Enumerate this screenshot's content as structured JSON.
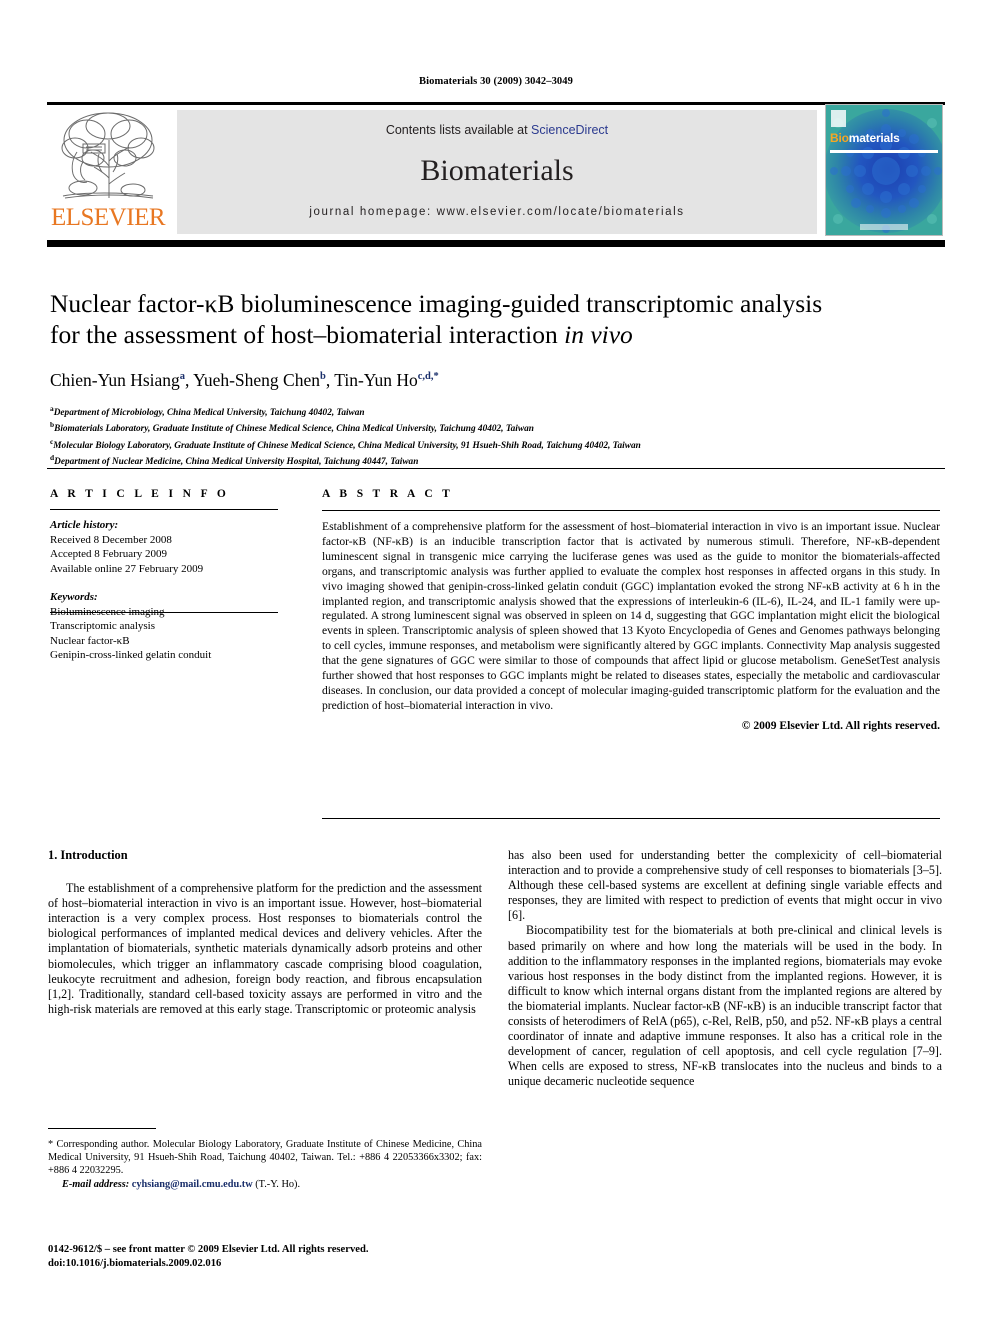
{
  "running_head": "Biomaterials 30 (2009) 3042–3049",
  "masthead": {
    "contents_prefix": "Contents lists available at ",
    "sciencedirect": "ScienceDirect",
    "journal_name": "Biomaterials",
    "homepage": "journal homepage: www.elsevier.com/locate/biomaterials",
    "elsevier_wordmark": "ELSEVIER",
    "elsevier_color": "#E87722",
    "link_color": "#2b3a8f",
    "cover": {
      "title_bio": "Bio",
      "title_materials": "materials",
      "background_color": "#2e9a9c",
      "accent_color": "#1f3f9e"
    }
  },
  "article": {
    "title_line1": "Nuclear factor-κB bioluminescence imaging-guided transcriptomic analysis",
    "title_line2_plain": "for the assessment of host–biomaterial interaction ",
    "title_line2_italic": "in vivo",
    "authors": [
      {
        "name": "Chien-Yun Hsiang",
        "marks": "a",
        "sep": ", "
      },
      {
        "name": "Yueh-Sheng Chen",
        "marks": "b",
        "sep": ", "
      },
      {
        "name": "Tin-Yun Ho",
        "marks": "c,d,*",
        "sep": ""
      }
    ],
    "affiliations": [
      {
        "mark": "a",
        "text": "Department of Microbiology, China Medical University, Taichung 40402, Taiwan"
      },
      {
        "mark": "b",
        "text": "Biomaterials Laboratory, Graduate Institute of Chinese Medical Science, China Medical University, Taichung 40402, Taiwan"
      },
      {
        "mark": "c",
        "text": "Molecular Biology Laboratory, Graduate Institute of Chinese Medical Science, China Medical University, 91 Hsueh-Shih Road, Taichung 40402, Taiwan"
      },
      {
        "mark": "d",
        "text": "Department of Nuclear Medicine, China Medical University Hospital, Taichung 40447, Taiwan"
      }
    ]
  },
  "article_info": {
    "heading": "A R T I C L E   I N F O",
    "history_label": "Article history:",
    "history": [
      "Received 8 December 2008",
      "Accepted 8 February 2009",
      "Available online 27 February 2009"
    ],
    "keywords_label": "Keywords:",
    "keywords": [
      "Bioluminescence imaging",
      "Transcriptomic analysis",
      "Nuclear factor-κB",
      "Genipin-cross-linked gelatin conduit"
    ]
  },
  "abstract": {
    "heading": "A B S T R A C T",
    "paragraph": "Establishment of a comprehensive platform for the assessment of host–biomaterial interaction in vivo is an important issue. Nuclear factor-κB (NF-κB) is an inducible transcription factor that is activated by numerous stimuli. Therefore, NF-κB-dependent luminescent signal in transgenic mice carrying the luciferase genes was used as the guide to monitor the biomaterials-affected organs, and transcriptomic analysis was further applied to evaluate the complex host responses in affected organs in this study. In vivo imaging showed that genipin-cross-linked gelatin conduit (GGC) implantation evoked the strong NF-κB activity at 6 h in the implanted region, and transcriptomic analysis showed that the expressions of interleukin-6 (IL-6), IL-24, and IL-1 family were up-regulated. A strong luminescent signal was observed in spleen on 14 d, suggesting that GGC implantation might elicit the biological events in spleen. Transcriptomic analysis of spleen showed that 13 Kyoto Encyclopedia of Genes and Genomes pathways belonging to cell cycles, immune responses, and metabolism were significantly altered by GGC implants. Connectivity Map analysis suggested that the gene signatures of GGC were similar to those of compounds that affect lipid or glucose metabolism. GeneSetTest analysis further showed that host responses to GGC implants might be related to diseases states, especially the metabolic and cardiovascular diseases. In conclusion, our data provided a concept of molecular imaging-guided transcriptomic platform for the evaluation and the prediction of host–biomaterial interaction in vivo.",
    "copyright": "© 2009 Elsevier Ltd. All rights reserved."
  },
  "body": {
    "section_number_title": "1.  Introduction",
    "left_paragraph": "The establishment of a comprehensive platform for the prediction and the assessment of host–biomaterial interaction in vivo is an important issue. However, host–biomaterial interaction is a very complex process. Host responses to biomaterials control the biological performances of implanted medical devices and delivery vehicles. After the implantation of biomaterials, synthetic materials dynamically adsorb proteins and other biomolecules, which trigger an inflammatory cascade comprising blood coagulation, leukocyte recruitment and adhesion, foreign body reaction, and fibrous encapsulation [1,2]. Traditionally, standard cell-based toxicity assays are performed in vitro and the high-risk materials are removed at this early stage. Transcriptomic or proteomic analysis",
    "right_paragraph_1": "has also been used for understanding better the complexicity of cell–biomaterial interaction and to provide a comprehensive study of cell responses to biomaterials [3–5]. Although these cell-based systems are excellent at defining single variable effects and responses, they are limited with respect to prediction of events that might occur in vivo [6].",
    "right_paragraph_2": "Biocompatibility test for the biomaterials at both pre-clinical and clinical levels is based primarily on where and how long the materials will be used in the body. In addition to the inflammatory responses in the implanted regions, biomaterials may evoke various host responses in the body distinct from the implanted regions. However, it is difficult to know which internal organs distant from the implanted regions are altered by the biomaterial implants. Nuclear factor-κB (NF-κB) is an inducible transcript factor that consists of heterodimers of RelA (p65), c-Rel, RelB, p50, and p52. NF-κB plays a central coordinator of innate and adaptive immune responses. It also has a critical role in the development of cancer, regulation of cell apoptosis, and cell cycle regulation [7–9]. When cells are exposed to stress, NF-κB translocates into the nucleus and binds to a unique decameric nucleotide sequence"
  },
  "footnote": {
    "corresponding": "* Corresponding author. Molecular Biology Laboratory, Graduate Institute of Chinese Medicine, China Medical University, 91 Hsueh-Shih Road, Taichung 40402, Taiwan. Tel.: +886 4 22053366x3302; fax: +886 4 22032295.",
    "email_label": "E-mail address:",
    "email": "cyhsiang@mail.cmu.edu.tw",
    "email_suffix": "(T.-Y. Ho)."
  },
  "imprint": {
    "line1": "0142-9612/$ – see front matter © 2009 Elsevier Ltd. All rights reserved.",
    "line2": "doi:10.1016/j.biomaterials.2009.02.016"
  }
}
